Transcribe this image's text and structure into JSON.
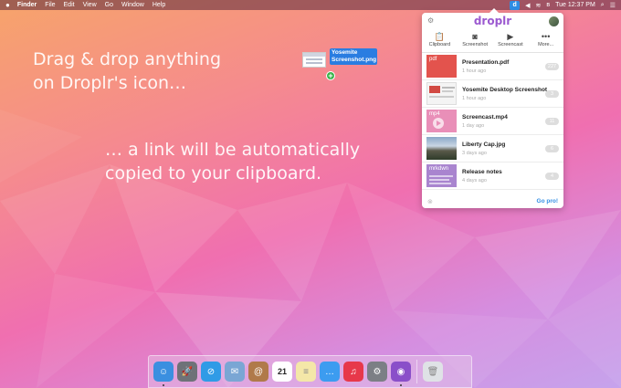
{
  "menubar": {
    "apple": "",
    "items": [
      "Finder",
      "File",
      "Edit",
      "View",
      "Go",
      "Window",
      "Help"
    ],
    "time": "Tue 12:37 PM",
    "droplr_status_icon": "droplr-icon",
    "status_icons": [
      "droplr-icon",
      "volume-icon",
      "wifi-icon",
      "bluetooth-icon",
      "spotlight-icon",
      "notification-center-icon"
    ]
  },
  "hero": {
    "line1": "Drag & drop anything",
    "line2": "on Droplr's icon…",
    "line3": "… a link will be automatically",
    "line4": "copied to your clipboard."
  },
  "drag": {
    "label_line1": "Yosemite",
    "label_line2": "Screenshot.png",
    "plus": "+"
  },
  "popover": {
    "logo": "droplr",
    "tools": [
      {
        "label": "Clipboard",
        "icon": "clipboard-icon"
      },
      {
        "label": "Screenshot",
        "icon": "camera-icon"
      },
      {
        "label": "Screencast",
        "icon": "video-icon"
      },
      {
        "label": "More...",
        "icon": "more-icon"
      }
    ],
    "files": [
      {
        "name": "Presentation.pdf",
        "time": "1 hour ago",
        "badge": "227",
        "thumb": "pdf",
        "thumb_label": "pdf"
      },
      {
        "name": "Yosemite Desktop Screenshot",
        "time": "1 hour ago",
        "badge": "3",
        "thumb": "screenshot",
        "thumb_label": ""
      },
      {
        "name": "Screencast.mp4",
        "time": "1 day ago",
        "badge": "11",
        "thumb": "video",
        "thumb_label": "mp4"
      },
      {
        "name": "Liberty Cap.jpg",
        "time": "3 days ago",
        "badge": "6",
        "thumb": "photo",
        "thumb_label": ""
      },
      {
        "name": "Release notes",
        "time": "4 days ago",
        "badge": "4",
        "thumb": "text",
        "thumb_label": "mrkdwn"
      }
    ],
    "footer_link": "Go pro!"
  },
  "dock": {
    "apps": [
      {
        "name": "finder",
        "color": "#3b8fe0",
        "glyph": "☺",
        "running": true
      },
      {
        "name": "launchpad",
        "color": "#6e7278",
        "glyph": "🚀",
        "running": false
      },
      {
        "name": "safari",
        "color": "#2f9be6",
        "glyph": "⊘",
        "running": false
      },
      {
        "name": "mail",
        "color": "#7aa6d4",
        "glyph": "✉",
        "running": false
      },
      {
        "name": "contacts",
        "color": "#b07a4a",
        "glyph": "@",
        "running": false
      },
      {
        "name": "calendar",
        "color": "#ffffff",
        "glyph": "21",
        "running": false
      },
      {
        "name": "notes",
        "color": "#f4e7a8",
        "glyph": "≡",
        "running": false
      },
      {
        "name": "messages",
        "color": "#3c9cf0",
        "glyph": "…",
        "running": false
      },
      {
        "name": "itunes",
        "color": "#e7384a",
        "glyph": "♫",
        "running": false
      },
      {
        "name": "system-preferences",
        "color": "#7c7f85",
        "glyph": "⚙",
        "running": false
      },
      {
        "name": "droplr",
        "color": "#8a4fc9",
        "glyph": "◉",
        "running": true
      }
    ],
    "trash": {
      "name": "trash",
      "color": "#dfe2e6",
      "glyph": "🗑"
    }
  }
}
